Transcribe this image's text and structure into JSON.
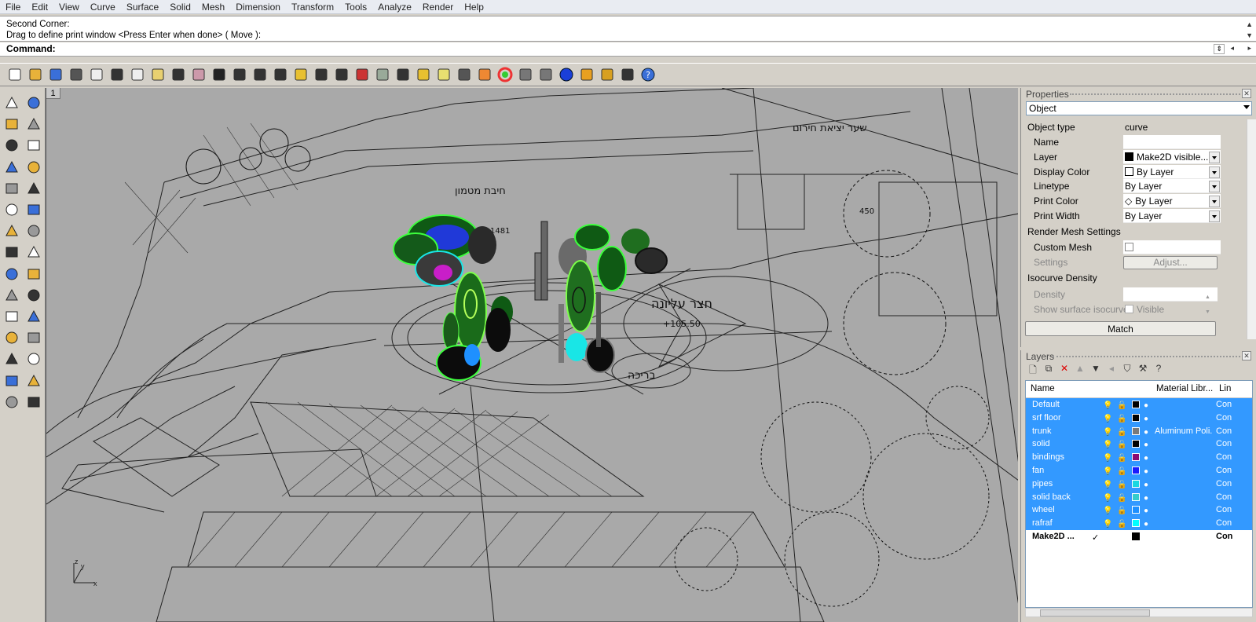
{
  "menu": [
    "File",
    "Edit",
    "View",
    "Curve",
    "Surface",
    "Solid",
    "Mesh",
    "Dimension",
    "Transform",
    "Tools",
    "Analyze",
    "Render",
    "Help"
  ],
  "command": {
    "history": [
      "Second Corner:",
      "Drag to define print window <Press Enter when done> ( Move ):"
    ],
    "prompt": "Command:"
  },
  "viewport": {
    "label": "1",
    "hebrew": [
      "שער יציאת חירום",
      "חיבת מטמון",
      "חצר עליונה",
      "בריכה"
    ],
    "numbers": [
      "1481",
      "+105.50",
      "450"
    ]
  },
  "properties": {
    "title": "Properties",
    "selector": "Object",
    "object_type_label": "Object type",
    "object_type_value": "curve",
    "rows": [
      {
        "label": "Name",
        "value": ""
      },
      {
        "label": "Layer",
        "value": "Make2D visible..."
      },
      {
        "label": "Display Color",
        "value": "By Layer"
      },
      {
        "label": "Linetype",
        "value": "By Layer"
      },
      {
        "label": "Print Color",
        "value": "By Layer"
      },
      {
        "label": "Print Width",
        "value": "By Layer"
      }
    ],
    "render_mesh_header": "Render Mesh Settings",
    "custom_mesh_label": "Custom Mesh",
    "settings_label": "Settings",
    "adjust_label": "Adjust...",
    "isocurve_header": "Isocurve Density",
    "density_label": "Density",
    "show_iso_label": "Show surface isocurve",
    "visible_label": "Visible",
    "match_label": "Match"
  },
  "layers": {
    "title": "Layers",
    "col_name": "Name",
    "col_material": "Material Libr...",
    "col_linetype": "Lin",
    "rows": [
      {
        "name": "Default",
        "color": "#000000",
        "material": "",
        "linetype": "Con"
      },
      {
        "name": "srf floor",
        "color": "#000000",
        "material": "",
        "linetype": "Con"
      },
      {
        "name": "trunk",
        "color": "#7a7a7a",
        "material": "Aluminum Poli...",
        "linetype": "Con"
      },
      {
        "name": "solid",
        "color": "#000000",
        "material": "",
        "linetype": "Con"
      },
      {
        "name": "bindings",
        "color": "#8b0a72",
        "material": "",
        "linetype": "Con"
      },
      {
        "name": "fan",
        "color": "#1a1aff",
        "material": "",
        "linetype": "Con"
      },
      {
        "name": "pipes",
        "color": "#19d8e0",
        "material": "",
        "linetype": "Con"
      },
      {
        "name": "solid back",
        "color": "#33cccc",
        "material": "",
        "linetype": "Con"
      },
      {
        "name": "wheel",
        "color": "#1e90ff",
        "material": "",
        "linetype": "Con"
      },
      {
        "name": "rafraf",
        "color": "#00ffff",
        "material": "",
        "linetype": "Con"
      }
    ],
    "current": {
      "name": "Make2D ...",
      "check": "✓",
      "linetype": "Con"
    }
  }
}
